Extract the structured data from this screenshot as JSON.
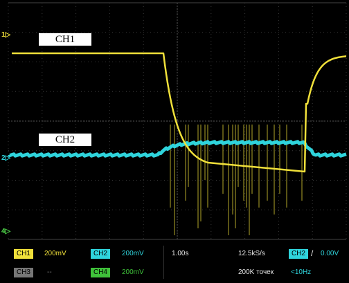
{
  "traces": {
    "ch1_label": "CH1",
    "ch2_label": "CH2",
    "colors": {
      "ch1": "#f0e03a",
      "ch2": "#2fd4dc",
      "ch3": "#777777",
      "ch4": "#3fc23a"
    }
  },
  "markers": {
    "ch1": "1▷",
    "ch2": "2▷",
    "ch4": "4▷"
  },
  "status": {
    "ch1_badge": "CH1",
    "ch1_scale": "200mV",
    "ch2_badge": "CH2",
    "ch2_scale": "200mV",
    "ch3_badge": "CH3",
    "ch3_scale": "--",
    "ch4_badge": "CH4",
    "ch4_scale": "200mV",
    "timebase": "1.00s",
    "sample_rate": "12.5kS/s",
    "record_length": "200K точек",
    "trigger_source": "CH2",
    "trigger_slope": "/",
    "trigger_level": "0.00V",
    "trigger_freq": "<10Hz"
  }
}
